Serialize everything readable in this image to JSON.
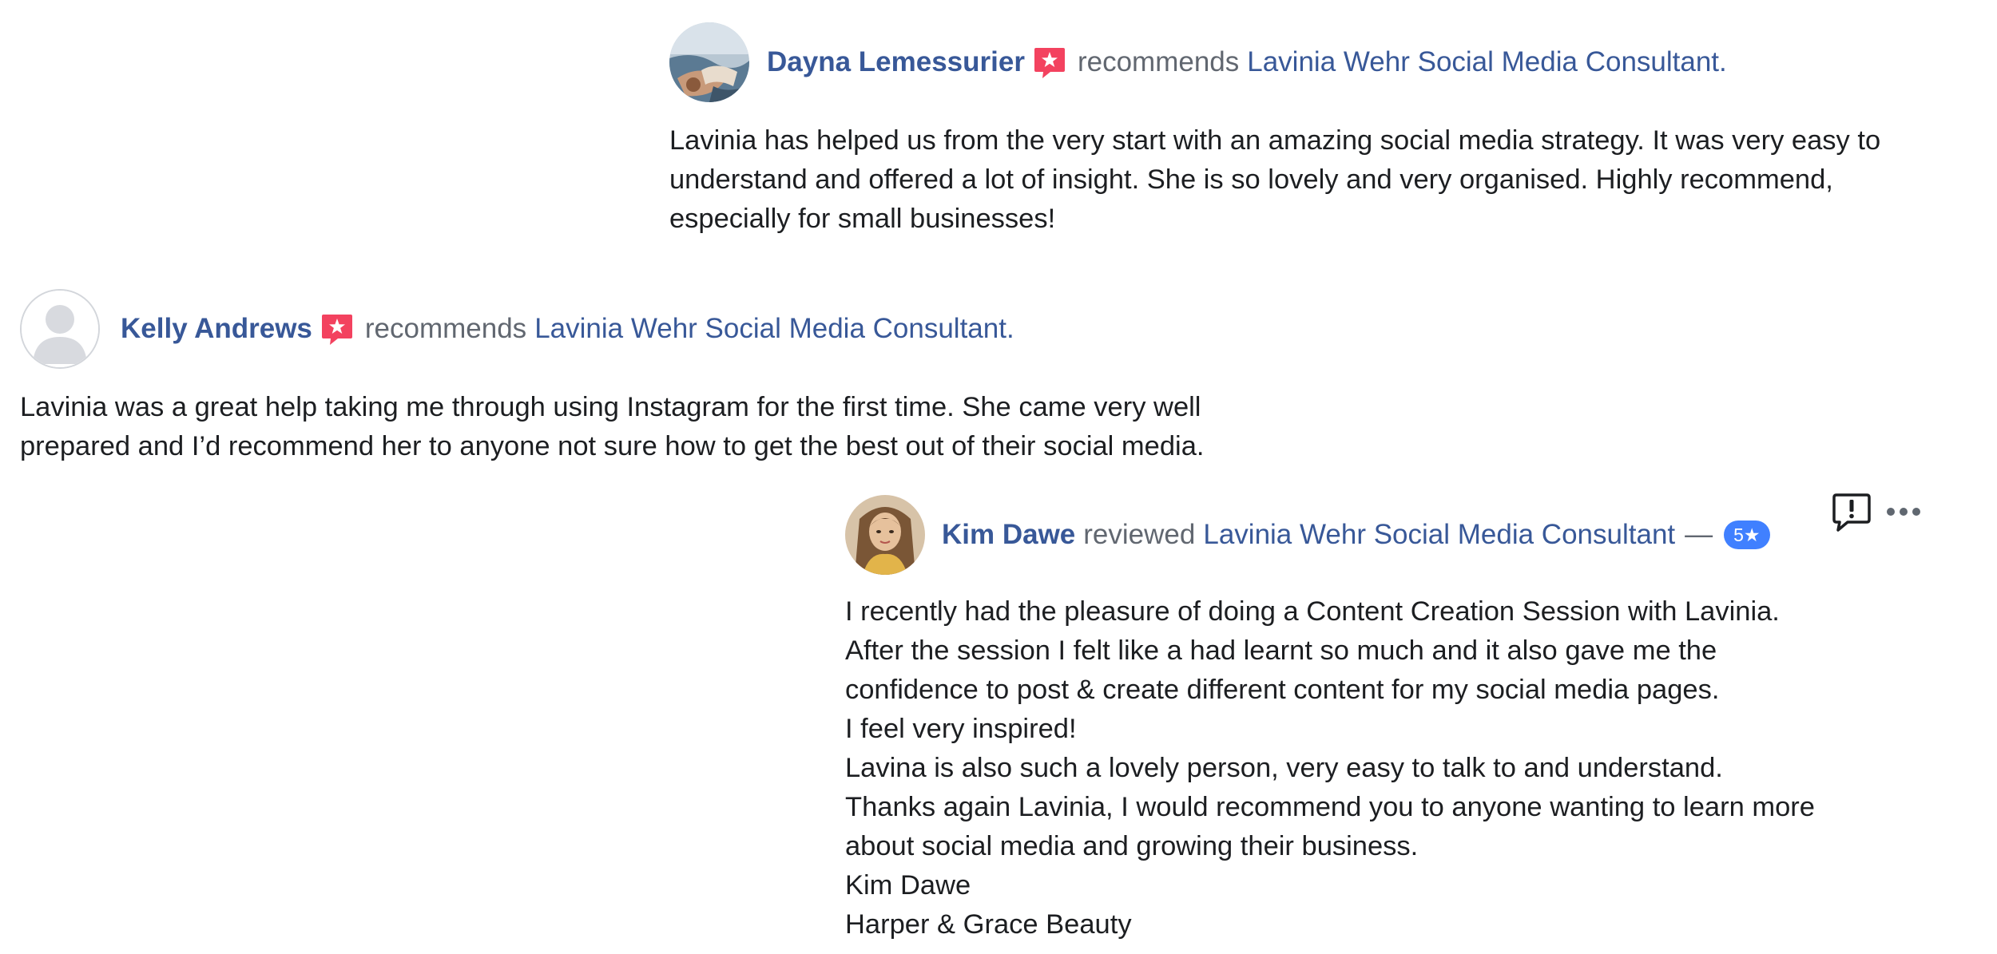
{
  "reviews": [
    {
      "name": "Dayna Lemessurier",
      "verb": "recommends",
      "page": "Lavinia Wehr Social Media Consultant.",
      "lines": [
        "Lavinia has helped us from the very start with an amazing social media strategy. It was very easy to",
        "understand and offered a lot of insight. She is so lovely and very organised. Highly recommend,",
        "especially for small businesses!"
      ]
    },
    {
      "name": "Kelly Andrews",
      "verb": "recommends",
      "page": "Lavinia Wehr Social Media Consultant.",
      "lines": [
        "Lavinia was a great help taking me through using Instagram for the first time. She came very well",
        "prepared and I’d recommend her to anyone not sure how to get the best out of their social media."
      ]
    },
    {
      "name": "Kim Dawe",
      "verb": "reviewed",
      "page": "Lavinia Wehr Social Media Consultant",
      "dash": "—",
      "rating": "5★",
      "lines": [
        "I recently had the pleasure of doing a Content Creation Session with Lavinia.",
        "After the session I felt like a had learnt so much and it also gave me the",
        "confidence to post & create different content for my social media pages.",
        "I feel very inspired!",
        "Lavina is also such a lovely person, very easy to talk to and understand.",
        "Thanks again Lavinia, I would recommend you to anyone wanting to learn more",
        "about social media and growing their business.",
        "Kim Dawe",
        "Harper & Grace Beauty"
      ]
    }
  ],
  "icons": {
    "recommend": "recommend-star-icon",
    "report": "report-icon",
    "more": "more-options-icon"
  },
  "colors": {
    "link": "#385898",
    "muted": "#616770",
    "text": "#1c1e21",
    "recommend_badge": "#f3425f",
    "rating_badge": "#4080ff"
  }
}
